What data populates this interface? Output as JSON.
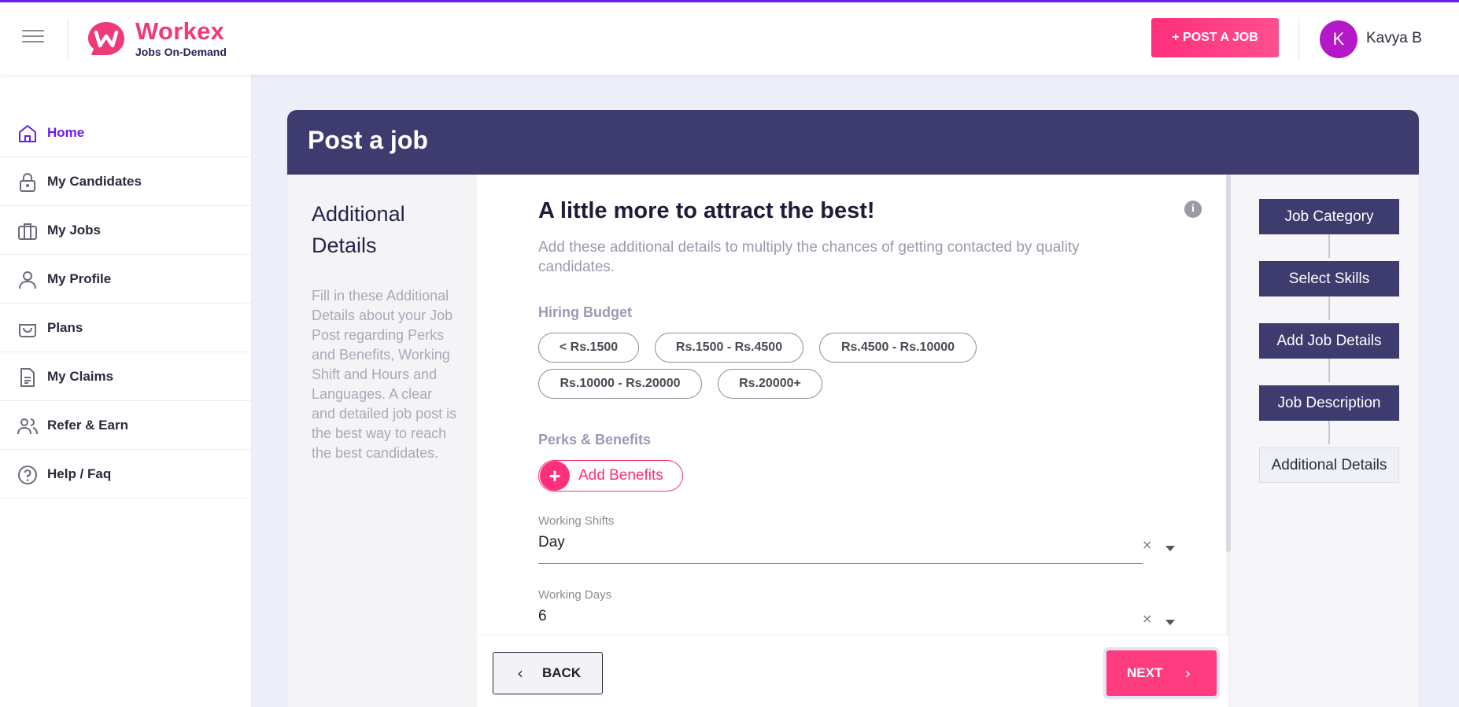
{
  "header": {
    "brand_name": "Workex",
    "brand_tagline": "Jobs On-Demand",
    "post_job_label": "+ POST A JOB",
    "user_initial": "K",
    "user_name": "Kavya B"
  },
  "sidebar": {
    "items": [
      {
        "label": "Home",
        "icon": "home-icon",
        "active": true
      },
      {
        "label": "My Candidates",
        "icon": "lock-icon"
      },
      {
        "label": "My Jobs",
        "icon": "briefcase-icon"
      },
      {
        "label": "My Profile",
        "icon": "user-icon"
      },
      {
        "label": "Plans",
        "icon": "basket-icon"
      },
      {
        "label": "My Claims",
        "icon": "document-icon"
      },
      {
        "label": "Refer & Earn",
        "icon": "users-icon"
      },
      {
        "label": "Help / Faq",
        "icon": "help-icon"
      }
    ]
  },
  "page": {
    "title": "Post a job"
  },
  "left_pane": {
    "title": "Additional Details",
    "description": "Fill in these Additional Details about your Job Post regarding Perks and Benefits, Working Shift and Hours and Languages. A clear and detailed job post is the best way to reach the best candidates."
  },
  "form": {
    "heading": "A little more to attract the best!",
    "subheading": "Add these additional details to multiply the chances of getting contacted by quality candidates.",
    "hiring_budget_label": "Hiring Budget",
    "budget_options": [
      "< Rs.1500",
      "Rs.1500 - Rs.4500",
      "Rs.4500 - Rs.10000",
      "Rs.10000 - Rs.20000",
      "Rs.20000+"
    ],
    "perks_label": "Perks & Benefits",
    "add_benefits_label": "Add Benefits",
    "working_shifts": {
      "label": "Working Shifts",
      "value": "Day"
    },
    "working_days": {
      "label": "Working Days",
      "value": "6"
    },
    "clear_glyph": "×"
  },
  "footer": {
    "back_label": "BACK",
    "next_label": "NEXT"
  },
  "steps": [
    {
      "label": "Job Category",
      "state": "done"
    },
    {
      "label": "Select Skills",
      "state": "done"
    },
    {
      "label": "Add Job Details",
      "state": "done"
    },
    {
      "label": "Job Description",
      "state": "done"
    },
    {
      "label": "Additional Details",
      "state": "current"
    }
  ],
  "colors": {
    "accent": "#6a1bf0",
    "brand_pink": "#ff2f7b",
    "header_navy": "#3e3b6e",
    "avatar": "#b418c8"
  }
}
